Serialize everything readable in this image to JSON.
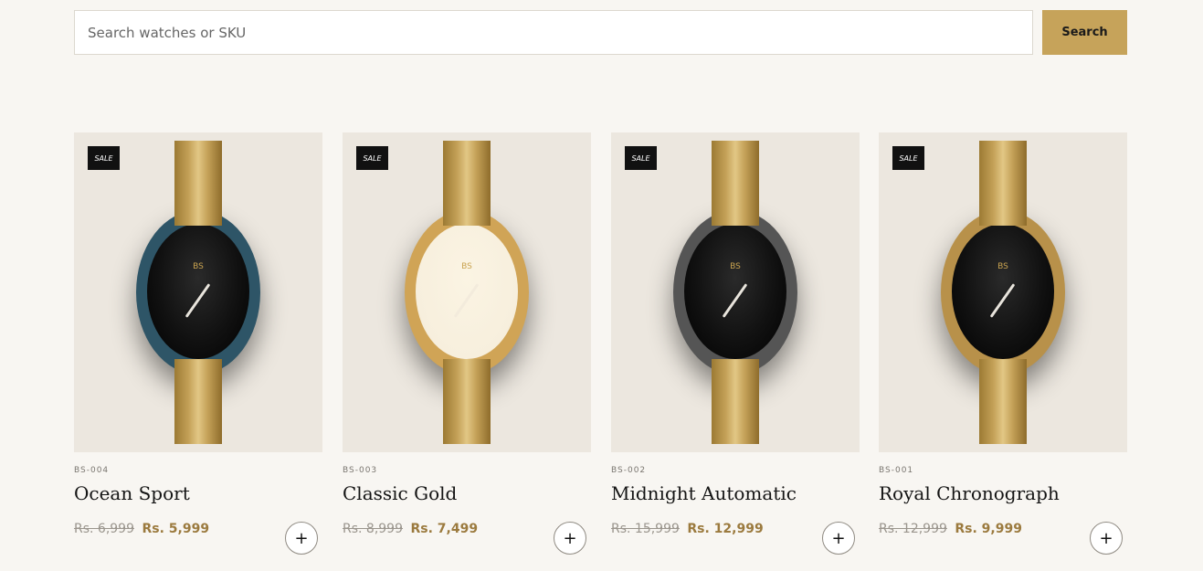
{
  "search": {
    "placeholder": "Search watches or SKU",
    "value": "",
    "button_label": "Search"
  },
  "products": [
    {
      "badge": "SALE",
      "sku": "BS-004",
      "name": "Ocean Sport",
      "old_price": "Rs. 6,999",
      "price": "Rs. 5,999",
      "brand_mark": "BS",
      "add_label": "+",
      "case_color": "#2e5567",
      "face": "dark"
    },
    {
      "badge": "SALE",
      "sku": "BS-003",
      "name": "Classic Gold",
      "old_price": "Rs. 8,999",
      "price": "Rs. 7,499",
      "brand_mark": "BS",
      "add_label": "+",
      "case_color": "#d0a456",
      "face": "light"
    },
    {
      "badge": "SALE",
      "sku": "BS-002",
      "name": "Midnight Automatic",
      "old_price": "Rs. 15,999",
      "price": "Rs. 12,999",
      "brand_mark": "BS",
      "add_label": "+",
      "case_color": "#555555",
      "face": "dark"
    },
    {
      "badge": "SALE",
      "sku": "BS-001",
      "name": "Royal Chronograph",
      "old_price": "Rs. 12,999",
      "price": "Rs. 9,999",
      "brand_mark": "BS",
      "add_label": "+",
      "case_color": "#b8914a",
      "face": "dark"
    }
  ]
}
